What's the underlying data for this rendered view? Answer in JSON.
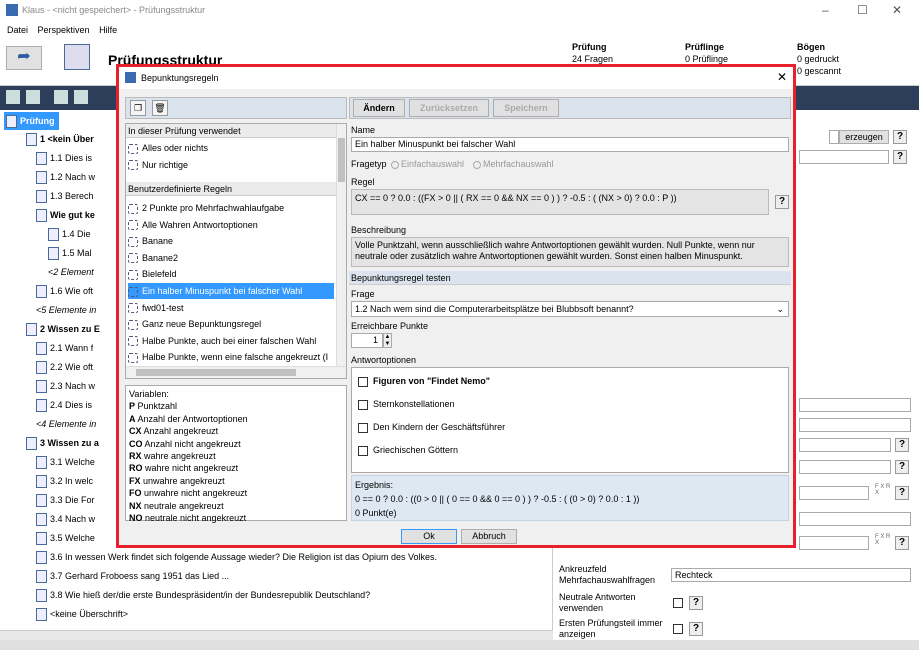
{
  "window": {
    "title": "Klaus - <nicht gespeichert> - Prüfungsstruktur",
    "min": "–",
    "max": "☐",
    "close": "✕"
  },
  "menu": [
    "Datei",
    "Perspektiven",
    "Hilfe"
  ],
  "header": {
    "title": "Prüfungsstruktur",
    "cols": [
      {
        "h": "Prüfung",
        "v": "24 Fragen"
      },
      {
        "h": "Prüflinge",
        "v": "0 Prüflinge"
      },
      {
        "h": "Bögen",
        "v1": "0 gedruckt",
        "v2": "0 gescannt"
      }
    ]
  },
  "tree": {
    "root": "Prüfung",
    "rows": [
      "1 <kein Über",
      "1.1 Dies is",
      "1.2 Nach w",
      "1.3 Berech",
      "Wie gut ke",
      "1.4 Die",
      "1.5 Mal",
      "<2 Element",
      "1.6 Wie oft",
      "<5 Elemente in",
      "2 Wissen zu E",
      "2.1 Wann f",
      "2.2 Wie oft",
      "2.3 Nach w",
      "2.4 Dies is",
      "<4 Elemente in",
      "3 Wissen zu a",
      "3.1 Welche",
      "3.2 In welc",
      "3.3 Die For",
      "3.4 Nach w",
      "3.5 Welche",
      "3.6 In wessen Werk findet sich folgende Aussage wieder? Die Religion ist das Opium des Volkes.",
      "3.7 Gerhard Froboess sang 1951 das Lied ...",
      "3.8 Wie hieß der/die erste Bundespräsident/in der Bundesrepublik Deutschland?",
      "<keine Überschrift>"
    ]
  },
  "props": {
    "create": "erzeugen",
    "rows": [
      {
        "label": "Ankreuzfeld Mehrfachauswahlfragen",
        "value": "Rechteck"
      },
      {
        "label": "Neutrale Antworten verwenden"
      },
      {
        "label": "Ersten Prüfungsteil immer anzeigen"
      }
    ],
    "fx": "F X R X"
  },
  "dialog": {
    "title": "Bepunktungsregeln",
    "close": "✕",
    "sec_used": "In dieser Prüfung verwendet",
    "used": [
      "Alles oder nichts",
      "Nur richtige"
    ],
    "sec_custom": "Benutzerdefinierte Regeln",
    "custom": [
      "2 Punkte pro Mehrfachwahlaufgabe",
      "Alle Wahren  Antwortoptionen",
      "Banane",
      "Banane2",
      "Bielefeld",
      "Ein halber Minuspunkt bei falscher Wahl",
      "fwd01-test",
      "Ganz neue Bepunktungsregel",
      "Halbe Punkte, auch bei einer falschen Wahl",
      "Halbe Punkte, wenn eine falsche angekreuzt (I"
    ],
    "selected_index": 5,
    "variables_title": "Variablen:",
    "variables": [
      {
        "k": "P",
        "v": "Punktzahl"
      },
      {
        "k": "A",
        "v": "Anzahl der Antwortoptionen"
      },
      {
        "k": "CX",
        "v": "Anzahl angekreuzt"
      },
      {
        "k": "CO",
        "v": "Anzahl nicht angekreuzt"
      },
      {
        "k": "RX",
        "v": "wahre angekreuzt"
      },
      {
        "k": "RO",
        "v": "wahre nicht angekreuzt"
      },
      {
        "k": "FX",
        "v": "unwahre angekreuzt"
      },
      {
        "k": "FO",
        "v": "unwahre nicht angekreuzt"
      },
      {
        "k": "NX",
        "v": "neutrale angekreuzt"
      },
      {
        "k": "NO",
        "v": "neutrale nicht angekreuzt"
      }
    ],
    "toolbar": {
      "change": "Ändern",
      "reset": "Zurücksetzen",
      "save": "Speichern"
    },
    "name_label": "Name",
    "name": "Ein halber Minuspunkt bei falscher Wahl",
    "type_label": "Fragetyp",
    "type_single": "Einfachauswahl",
    "type_multi": "Mehrfachauswahl",
    "rule_label": "Regel",
    "rule": "CX == 0 ? 0.0 : ((FX > 0 || ( RX == 0 && NX == 0 ) ) ? -0.5 : ( (NX > 0) ? 0.0 : P ))",
    "desc_label": "Beschreibung",
    "desc": "Volle Punktzahl, wenn ausschließlich wahre Antwortoptionen gewählt wurden. Null Punkte, wenn nur neutrale oder zusätzlich wahre Antwortoptionen gewählt wurden. Sonst einen halben Minuspunkt.",
    "test_sec": "Bepunktungsregel testen",
    "q_label": "Frage",
    "question": "1.2  Nach wem sind die Computerarbeitsplätze bei Blubbsoft benannt?",
    "points_label": "Erreichbare Punkte",
    "points": "1",
    "opts_label": "Antwortoptionen",
    "options": [
      "Figuren von \"Findet Nemo\"",
      "Sternkonstellationen",
      "Den Kindern der Geschäftsführer",
      "Griechischen Göttern"
    ],
    "result_label": "Ergebnis:",
    "result": "0 == 0 ? 0.0 : ((0 > 0 || ( 0 == 0 && 0 == 0 ) ) ? -0.5 : ( (0 > 0) ? 0.0 : 1 ))",
    "result_points": "0 Punkt(e)",
    "ok": "Ok",
    "cancel": "Abbruch",
    "help": "?"
  },
  "colors": {
    "accent": "#3399ff",
    "highlight": "#e8202a",
    "darkbar": "#2c3e5a"
  }
}
